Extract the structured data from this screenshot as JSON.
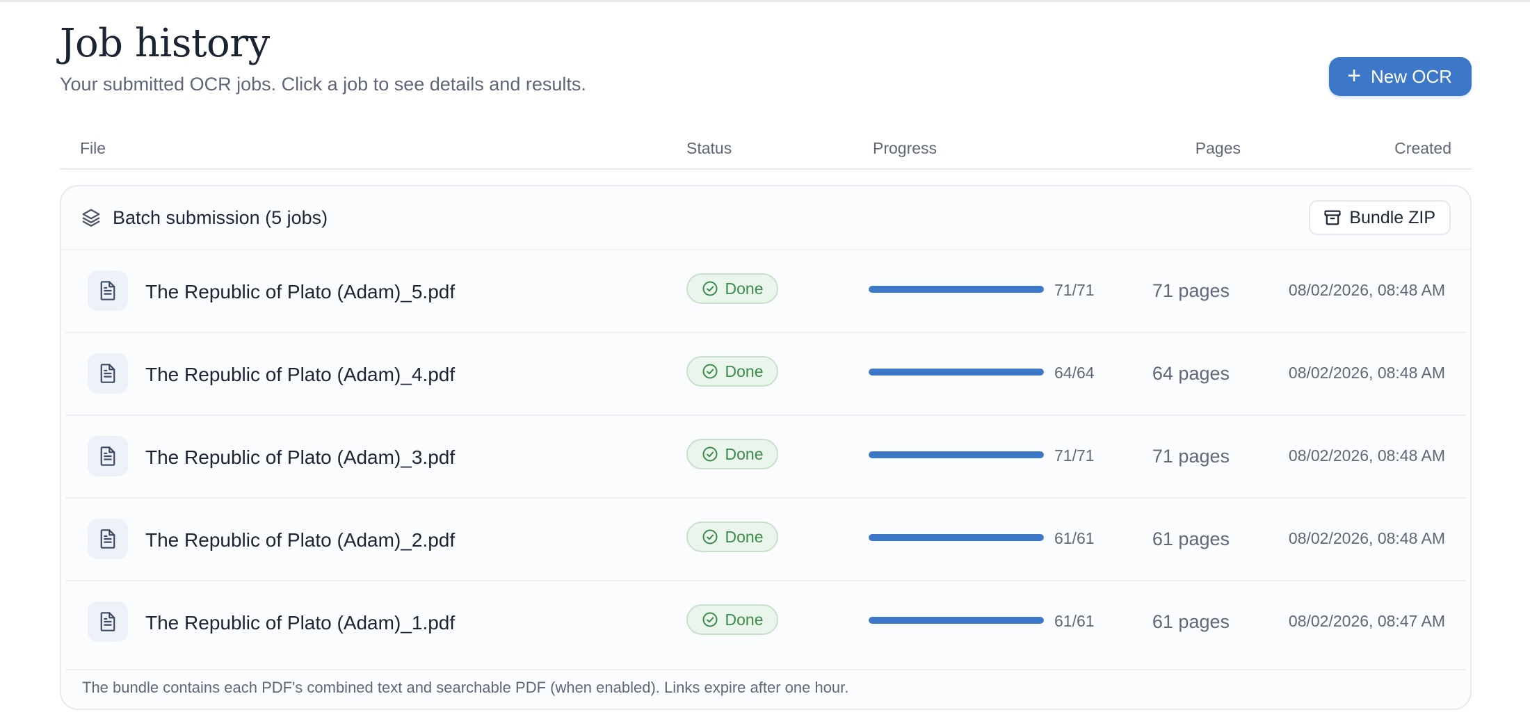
{
  "header": {
    "title": "Job history",
    "subtitle": "Your submitted OCR jobs. Click a job to see details and results.",
    "new_button_label": "New OCR",
    "new_button_icon": "plus-icon"
  },
  "columns": {
    "file": "File",
    "status": "Status",
    "progress": "Progress",
    "pages": "Pages",
    "created": "Created"
  },
  "batch": {
    "title": "Batch submission (5 jobs)",
    "icon": "layers-icon",
    "bundle_button_label": "Bundle ZIP",
    "bundle_button_icon": "archive-icon",
    "footnote": "The bundle contains each PDF's combined text and searchable PDF (when enabled). Links expire after one hour.",
    "jobs": [
      {
        "file": "The Republic of Plato (Adam)_5.pdf",
        "status": "Done",
        "progress_done": 71,
        "progress_total": 71,
        "progress_label": "71/71",
        "pages": "71 pages",
        "created": "08/02/2026, 08:48 AM"
      },
      {
        "file": "The Republic of Plato (Adam)_4.pdf",
        "status": "Done",
        "progress_done": 64,
        "progress_total": 64,
        "progress_label": "64/64",
        "pages": "64 pages",
        "created": "08/02/2026, 08:48 AM"
      },
      {
        "file": "The Republic of Plato (Adam)_3.pdf",
        "status": "Done",
        "progress_done": 71,
        "progress_total": 71,
        "progress_label": "71/71",
        "pages": "71 pages",
        "created": "08/02/2026, 08:48 AM"
      },
      {
        "file": "The Republic of Plato (Adam)_2.pdf",
        "status": "Done",
        "progress_done": 61,
        "progress_total": 61,
        "progress_label": "61/61",
        "pages": "61 pages",
        "created": "08/02/2026, 08:48 AM"
      },
      {
        "file": "The Republic of Plato (Adam)_1.pdf",
        "status": "Done",
        "progress_done": 61,
        "progress_total": 61,
        "progress_label": "61/61",
        "pages": "61 pages",
        "created": "08/02/2026, 08:47 AM"
      }
    ]
  },
  "colors": {
    "accent": "#3d78c8",
    "done_text": "#3a8a4a",
    "done_bg": "#eaf5eb"
  }
}
